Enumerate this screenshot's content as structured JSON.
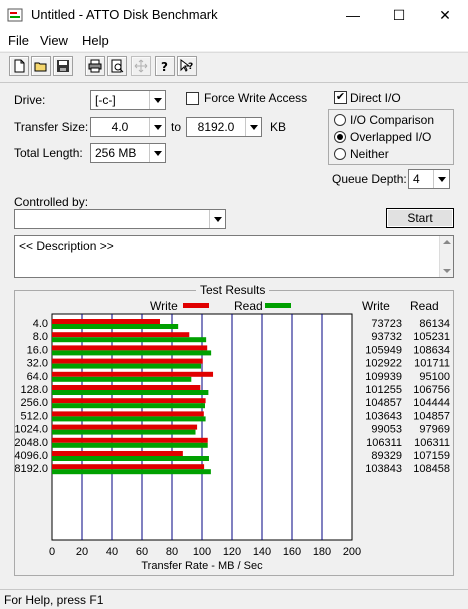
{
  "window": {
    "title": "Untitled - ATTO Disk Benchmark",
    "minimize_glyph": "—",
    "maximize_glyph": "☐",
    "close_glyph": "✕"
  },
  "menu": [
    {
      "label": "File"
    },
    {
      "label": "View"
    },
    {
      "label": "Help"
    }
  ],
  "toolbar": {
    "buttons": [
      "new-icon",
      "open-icon",
      "save-icon",
      "print-icon",
      "print-preview-icon",
      "move-icon",
      "help-icon",
      "context-help-icon"
    ]
  },
  "settings": {
    "drive_label": "Drive:",
    "drive_value": "[-c-]",
    "force_write_label": "Force Write Access",
    "force_write_checked": false,
    "transfer_size_label": "Transfer Size:",
    "transfer_from": "4.0",
    "to_label": "to",
    "transfer_to": "8192.0",
    "kb_label": "KB",
    "total_length_label": "Total Length:",
    "total_length_value": "256 MB",
    "direct_io_label": "Direct I/O",
    "direct_io_checked": true,
    "direct_io_check": "✔",
    "io_comparison_label": "I/O Comparison",
    "overlapped_io_label": "Overlapped I/O",
    "neither_label": "Neither",
    "selected_mode": "Overlapped I/O",
    "queue_depth_label": "Queue Depth:",
    "queue_depth_value": "4",
    "controlled_by_label": "Controlled by:",
    "controlled_by_value": "",
    "start_label": "Start",
    "description": "<< Description >>"
  },
  "results": {
    "title": "Test Results",
    "write_legend": "Write",
    "read_legend": "Read",
    "write_col": "Write",
    "read_col": "Read",
    "write_color": "#e00000",
    "read_color": "#00a000"
  },
  "chart_data": {
    "type": "bar",
    "orientation": "horizontal",
    "categories": [
      "4.0",
      "8.0",
      "16.0",
      "32.0",
      "64.0",
      "128.0",
      "256.0",
      "512.0",
      "1024.0",
      "2048.0",
      "4096.0",
      "8192.0"
    ],
    "series": [
      {
        "name": "Write",
        "values": [
          73723,
          93732,
          105949,
          102922,
          109939,
          101255,
          104857,
          103643,
          99053,
          106311,
          89329,
          103843
        ]
      },
      {
        "name": "Read",
        "values": [
          86134,
          105231,
          108634,
          101711,
          95100,
          106756,
          104444,
          104857,
          97969,
          106311,
          107159,
          108458
        ]
      }
    ],
    "xlabel": "Transfer Rate - MB / Sec",
    "xlim": [
      0,
      200
    ],
    "xticks": [
      "0",
      "20",
      "40",
      "60",
      "80",
      "100",
      "120",
      "140",
      "160",
      "180",
      "200"
    ],
    "grid": true,
    "legend": "top"
  },
  "status": {
    "text": "For Help, press F1"
  }
}
